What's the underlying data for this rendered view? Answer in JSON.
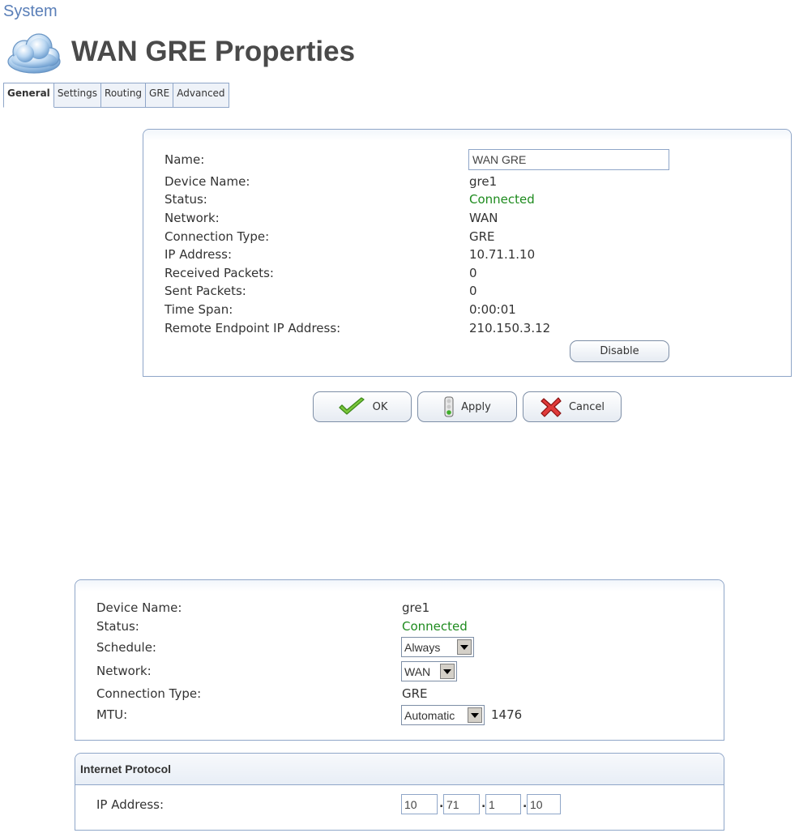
{
  "breadcrumb": "System",
  "page_title": "WAN GRE Properties",
  "tabs": [
    "General",
    "Settings",
    "Routing",
    "GRE",
    "Advanced"
  ],
  "general": {
    "labels": {
      "name": "Name:",
      "device_name": "Device Name:",
      "status": "Status:",
      "network": "Network:",
      "connection_type": "Connection Type:",
      "ip_address": "IP Address:",
      "received_packets": "Received Packets:",
      "sent_packets": "Sent Packets:",
      "time_span": "Time Span:",
      "remote_endpoint": "Remote Endpoint IP Address:"
    },
    "values": {
      "name": "WAN GRE",
      "device_name": "gre1",
      "status": "Connected",
      "network": "WAN",
      "connection_type": "GRE",
      "ip_address": "10.71.1.10",
      "received_packets": "0",
      "sent_packets": "0",
      "time_span": "0:00:01",
      "remote_endpoint": "210.150.3.12"
    },
    "disable_label": "Disable"
  },
  "actions": {
    "ok": "OK",
    "apply": "Apply",
    "cancel": "Cancel"
  },
  "settings": {
    "labels": {
      "device_name": "Device Name:",
      "status": "Status:",
      "schedule": "Schedule:",
      "network": "Network:",
      "connection_type": "Connection Type:",
      "mtu": "MTU:"
    },
    "values": {
      "device_name": "gre1",
      "status": "Connected",
      "schedule": "Always",
      "network": "WAN",
      "connection_type": "GRE",
      "mtu_mode": "Automatic",
      "mtu_value": "1476"
    }
  },
  "internet_protocol": {
    "title": "Internet Protocol",
    "ip_label": "IP Address:",
    "ip_parts": [
      "10",
      "71",
      "1",
      "10"
    ]
  },
  "colors": {
    "status_green": "#1e8b1e",
    "accent_blue": "#5a7fb8",
    "border_blue": "#8fa6c8"
  }
}
